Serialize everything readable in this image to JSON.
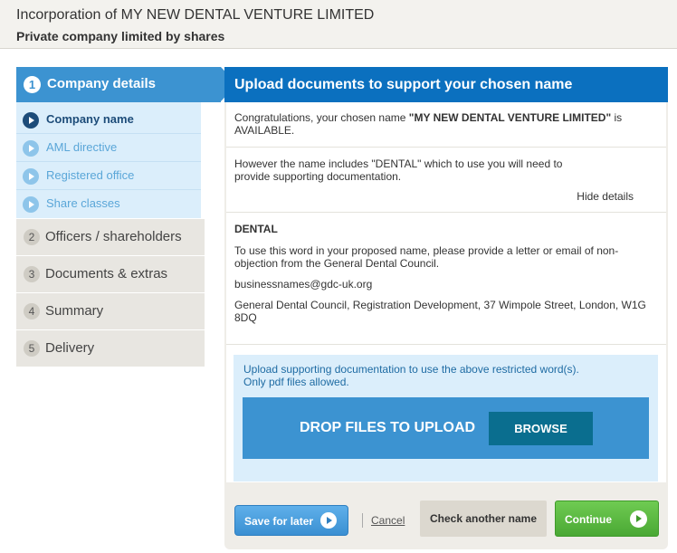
{
  "header": {
    "title": "Incorporation of MY NEW DENTAL VENTURE LIMITED",
    "subtitle": "Private company limited by shares"
  },
  "sidebar": {
    "active_step": {
      "number": "1",
      "label": "Company details"
    },
    "substeps": [
      {
        "label": "Company name",
        "current": true
      },
      {
        "label": "AML directive",
        "current": false
      },
      {
        "label": "Registered office",
        "current": false
      },
      {
        "label": "Share classes",
        "current": false
      }
    ],
    "steps": [
      {
        "number": "2",
        "label": "Officers / shareholders"
      },
      {
        "number": "3",
        "label": "Documents & extras"
      },
      {
        "number": "4",
        "label": "Summary"
      },
      {
        "number": "5",
        "label": "Delivery"
      }
    ]
  },
  "main": {
    "panel_title": "Upload documents to support your chosen name",
    "availability": {
      "prefix": "Congratulations, your chosen name ",
      "name": "\"MY NEW DENTAL VENTURE LIMITED\"",
      "suffix": " is AVAILABLE."
    },
    "restriction_line1": "However the name includes \"DENTAL\" which to use you will need to",
    "restriction_line2": "provide supporting documentation.",
    "hide_details": "Hide details",
    "word": "DENTAL",
    "instruction_line1": "To use this word in your proposed name, please provide a letter or email of non-",
    "instruction_line2": "objection from the General Dental Council.",
    "email": "businessnames@gdc-uk.org",
    "address_line1": "General Dental Council, Registration Development, 37 Wimpole Street, London, W1G",
    "address_line2": "8DQ",
    "upload": {
      "hint_line1": "Upload supporting documentation to use the above restricted word(s).",
      "hint_line2": "Only pdf files allowed.",
      "drop_label": "DROP FILES TO UPLOAD",
      "browse_label": "BROWSE"
    }
  },
  "footer": {
    "save_label": "Save for later",
    "cancel_label": "Cancel",
    "check_label": "Check another name",
    "continue_label": "Continue"
  },
  "colors": {
    "brand_blue": "#0b70bf",
    "sidebar_active": "#3c93d1",
    "continue_green": "#4aa834"
  }
}
